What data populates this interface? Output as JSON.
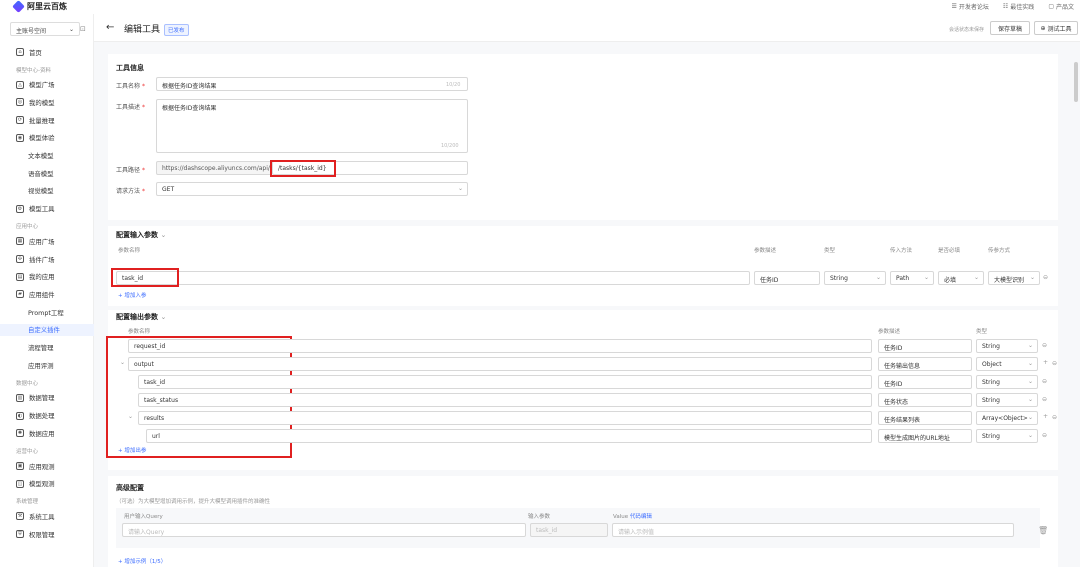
{
  "app": {
    "name": "阿里云百炼"
  },
  "top_links": [
    "开发者论坛",
    "最佳实践",
    "产品文"
  ],
  "sidebar": {
    "workspace": "主账号空间",
    "items": [
      {
        "label": "首页",
        "icon": "home-icon",
        "kind": "nav"
      },
      {
        "label": "模型中心-资料",
        "kind": "section"
      },
      {
        "label": "模型广场",
        "icon": "model-square-icon",
        "kind": "nav"
      },
      {
        "label": "我的模型",
        "icon": "my-model-icon",
        "kind": "nav"
      },
      {
        "label": "批量推理",
        "icon": "batch-icon",
        "kind": "nav"
      },
      {
        "label": "模型体验",
        "icon": "experience-icon",
        "kind": "nav",
        "expanded": true
      },
      {
        "label": "文本模型",
        "kind": "sub"
      },
      {
        "label": "语音模型",
        "kind": "sub"
      },
      {
        "label": "视觉模型",
        "kind": "sub"
      },
      {
        "label": "模型工具",
        "icon": "tool-icon",
        "kind": "nav",
        "collapsed": true
      },
      {
        "label": "应用中心",
        "kind": "section"
      },
      {
        "label": "应用广场",
        "icon": "app-square-icon",
        "kind": "nav"
      },
      {
        "label": "插件广场",
        "icon": "plugin-square-icon",
        "kind": "nav"
      },
      {
        "label": "我的应用",
        "icon": "my-app-icon",
        "kind": "nav"
      },
      {
        "label": "应用组件",
        "icon": "component-icon",
        "kind": "nav",
        "expanded": true,
        "active_parent": true
      },
      {
        "label": "Prompt工程",
        "kind": "sub"
      },
      {
        "label": "自定义插件",
        "kind": "sub",
        "active": true
      },
      {
        "label": "流程管理",
        "kind": "sub"
      },
      {
        "label": "应用评测",
        "kind": "sub"
      },
      {
        "label": "数据中心",
        "kind": "section"
      },
      {
        "label": "数据管理",
        "icon": "data-manage-icon",
        "kind": "nav"
      },
      {
        "label": "数据处理",
        "icon": "data-process-icon",
        "kind": "nav"
      },
      {
        "label": "数据应用",
        "icon": "data-app-icon",
        "kind": "nav",
        "expanded": true
      },
      {
        "label": "运营中心",
        "kind": "section"
      },
      {
        "label": "应用观测",
        "icon": "app-observe-icon",
        "kind": "nav"
      },
      {
        "label": "模型观测",
        "icon": "model-observe-icon",
        "kind": "nav"
      },
      {
        "label": "系统管理",
        "kind": "section"
      },
      {
        "label": "系统工具",
        "icon": "sys-tool-icon",
        "kind": "nav",
        "collapsed": true
      },
      {
        "label": "权限管理",
        "icon": "permission-icon",
        "kind": "nav",
        "collapsed": true
      }
    ]
  },
  "header": {
    "title": "编辑工具",
    "status_badge": "已发布",
    "save_info": "会话状态未保存",
    "save_draft": "保存草稿",
    "test_tool": "测试工具"
  },
  "tool_info": {
    "section_title": "工具信息",
    "name_label": "工具名称",
    "name_value": "根据任务ID查询结果",
    "name_count": "10/20",
    "desc_label": "工具描述",
    "desc_value": "根据任务ID查询结果",
    "desc_count": "10/200",
    "path_label": "工具路径",
    "path_base": "https://dashscope.aliyuncs.com/api/v1",
    "path_value": "/tasks/{task_id}",
    "method_label": "请求方法",
    "method_value": "GET"
  },
  "input_params": {
    "section_title": "配置输入参数",
    "headers": {
      "name": "参数名称",
      "desc": "参数描述",
      "type": "类型",
      "pass": "传入方法",
      "required": "是否必填",
      "mode": "传参方式"
    },
    "rows": [
      {
        "name": "task_id",
        "desc": "任务ID",
        "type": "String",
        "pass": "Path",
        "required": "必填",
        "mode": "大模型识别"
      }
    ],
    "add_label": "+ 增加入参"
  },
  "output_params": {
    "section_title": "配置输出参数",
    "headers": {
      "name": "参数名称",
      "desc": "参数描述",
      "type": "类型"
    },
    "rows": [
      {
        "name": "request_id",
        "desc": "任务ID",
        "type": "String",
        "level": 0,
        "collapsible": false
      },
      {
        "name": "output",
        "desc": "任务输出信息",
        "type": "Object",
        "level": 0,
        "collapsible": true
      },
      {
        "name": "task_id",
        "desc": "任务ID",
        "type": "String",
        "level": 1,
        "collapsible": false
      },
      {
        "name": "task_status",
        "desc": "任务状态",
        "type": "String",
        "level": 1,
        "collapsible": false
      },
      {
        "name": "results",
        "desc": "任务结果列表",
        "type": "Array<Object>",
        "level": 1,
        "collapsible": true
      },
      {
        "name": "url",
        "desc": "模型生成图片的URL地址",
        "type": "String",
        "level": 2,
        "collapsible": false
      }
    ],
    "add_label": "+ 增加出参"
  },
  "advanced": {
    "section_title": "高级配置",
    "subtitle": "（可选）为大模型增加调用示例，提升大模型调用插件的准确性",
    "col_query": "用户输入Query",
    "col_param": "输入参数",
    "col_value": "Value",
    "col_value_link": "代码编辑",
    "query_placeholder": "请输入Query",
    "param_value": "task_id",
    "value_placeholder": "请输入示例值",
    "add_example": "+ 增加示例（1/5）"
  }
}
